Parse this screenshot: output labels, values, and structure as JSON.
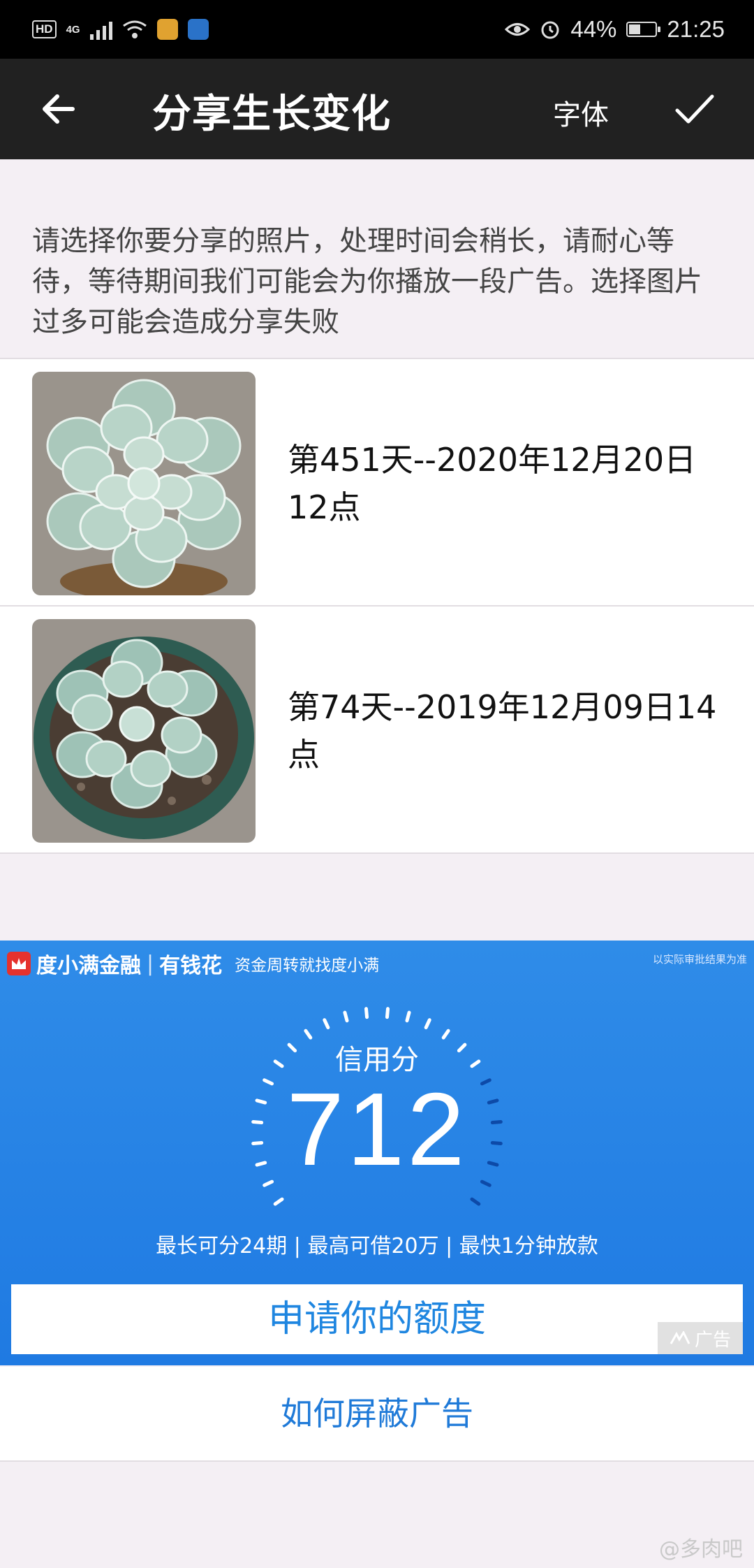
{
  "status_bar": {
    "hd": "HD",
    "net": "4G",
    "battery_percent": "44%",
    "battery_level": 0.44,
    "time": "21:25"
  },
  "app_bar": {
    "title": "分享生长变化",
    "font_label": "字体"
  },
  "instructions": "请选择你要分享的照片，处理时间会稍长，请耐心等待，等待期间我们可能会为你播放一段广告。选择图片过多可能会造成分享失败",
  "photos": [
    {
      "label": "第451天--2020年12月20日12点"
    },
    {
      "label": "第74天--2019年12月09日14点"
    }
  ],
  "ad": {
    "brand": "度小满金融",
    "separator": "|",
    "brand2": "有钱花",
    "slogan": "资金周转就找度小满",
    "disclaimer": "以实际审批结果为准",
    "score_label": "信用分",
    "score": "712",
    "features": "最长可分24期 | 最高可借20万 | 最快1分钟放款",
    "apply_label": "申请你的额度",
    "tag": "广告",
    "bg_color": "#2f8ce8"
  },
  "hide_ads_label": "如何屏蔽广告",
  "watermark": "@多肉吧"
}
